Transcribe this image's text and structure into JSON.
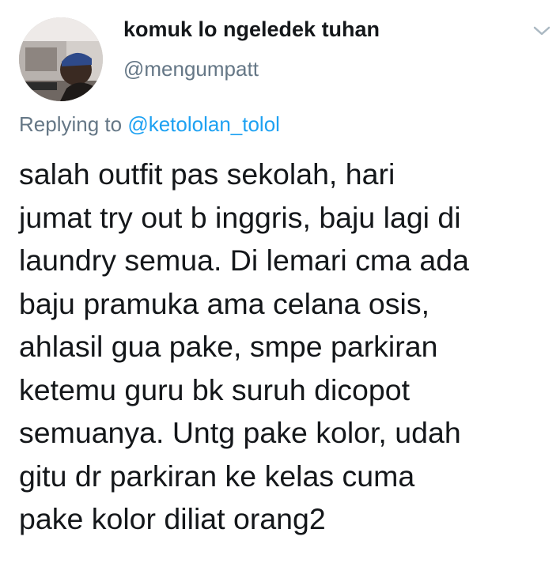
{
  "author": {
    "display_name": "komuk lo ngeledek tuhan",
    "handle": "@mengumpatt",
    "avatar_icon": "profile-photo"
  },
  "menu_icon": "chevron-down-icon",
  "reply": {
    "prefix": "Replying to",
    "mention": "@ketololan_tolol"
  },
  "tweet_lines": [
    "salah outfit pas sekolah, hari",
    "jumat try out b inggris, baju lagi di",
    "laundry semua. Di lemari cma ada",
    "baju pramuka ama celana osis,",
    "ahlasil gua pake, smpe parkiran",
    "ketemu guru bk suruh dicopot",
    "semuanya. Untg pake kolor, udah",
    "gitu dr parkiran ke kelas cuma",
    "pake kolor diliat orang2"
  ],
  "colors": {
    "text": "#14171a",
    "secondary": "#657786",
    "link": "#1da1f2"
  }
}
